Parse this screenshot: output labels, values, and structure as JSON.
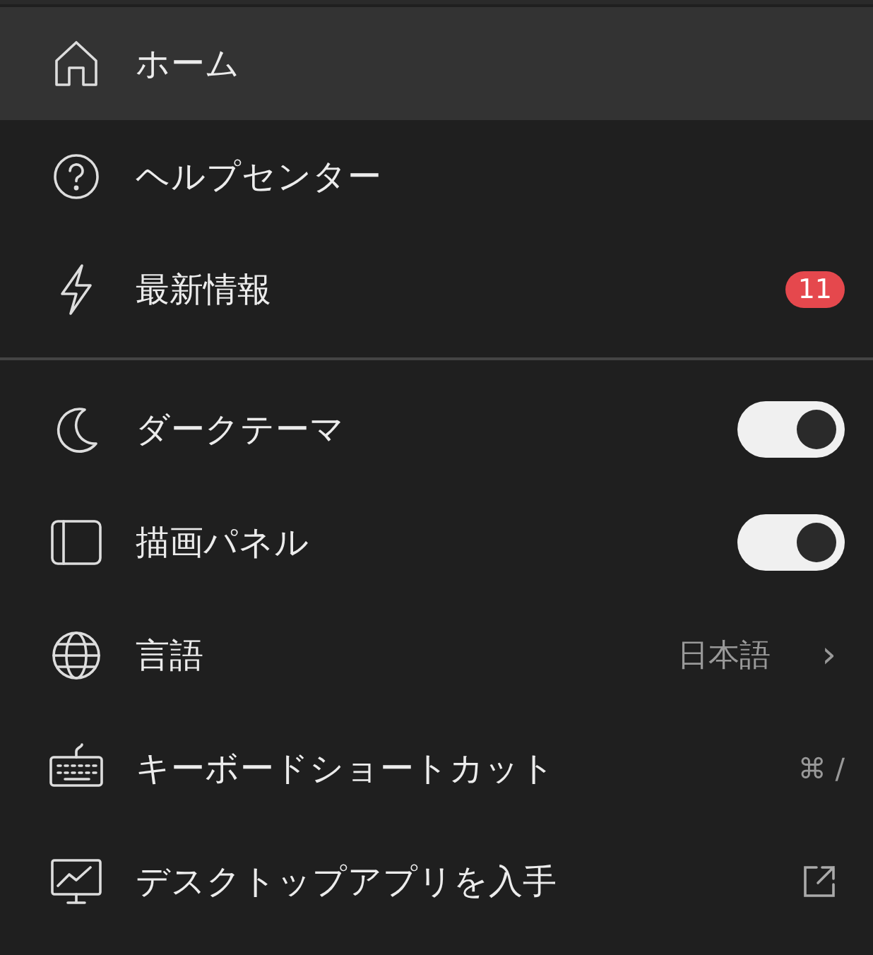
{
  "sections": [
    {
      "items": [
        {
          "kind": "link",
          "label": "ホーム",
          "selected": true
        },
        {
          "kind": "link",
          "label": "ヘルプセンター",
          "selected": false
        },
        {
          "kind": "badge",
          "label": "最新情報",
          "selected": false,
          "badge": "11"
        }
      ]
    },
    {
      "items": [
        {
          "kind": "toggle",
          "label": "ダークテーマ",
          "selected": false,
          "on": true
        },
        {
          "kind": "toggle",
          "label": "描画パネル",
          "selected": false,
          "on": true
        },
        {
          "kind": "value",
          "label": "言語",
          "selected": false,
          "value": "日本語",
          "arrow": "›"
        },
        {
          "kind": "shortcut",
          "label": "キーボードショートカット",
          "selected": false,
          "shortcut": "⌘ /"
        },
        {
          "kind": "external",
          "label": "デスクトップアプリを入手",
          "selected": false
        }
      ]
    }
  ]
}
